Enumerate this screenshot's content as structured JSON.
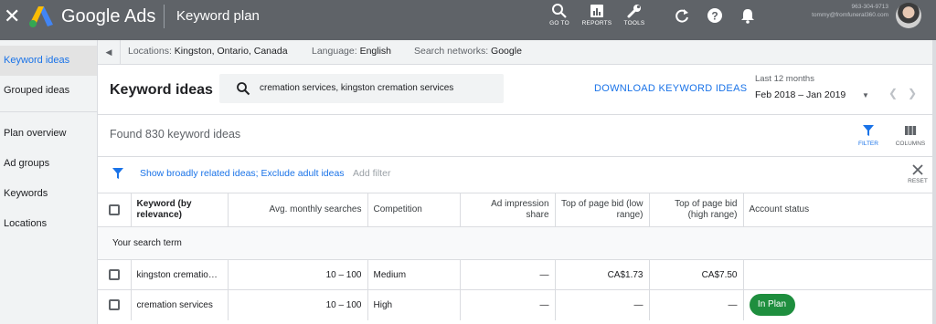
{
  "topbar": {
    "brand": "Google Ads",
    "page_title": "Keyword plan",
    "tools": [
      {
        "label": "GO TO",
        "icon": "search-icon"
      },
      {
        "label": "REPORTS",
        "icon": "reports-icon"
      },
      {
        "label": "TOOLS",
        "icon": "wrench-icon"
      }
    ],
    "account_id": "963-304-9713",
    "account_email": "tommy@fromfuneral360.com"
  },
  "sidebar": {
    "items": [
      {
        "label": "Keyword ideas",
        "active": true
      },
      {
        "label": "Grouped ideas"
      },
      {
        "label": "Plan overview"
      },
      {
        "label": "Ad groups"
      },
      {
        "label": "Keywords"
      },
      {
        "label": "Locations"
      }
    ]
  },
  "filterbar": {
    "locations_label": "Locations:",
    "locations_value": "Kingston, Ontario, Canada",
    "language_label": "Language:",
    "language_value": "English",
    "networks_label": "Search networks:",
    "networks_value": "Google"
  },
  "main": {
    "title": "Keyword ideas",
    "search_value": "cremation services, kingston cremation services",
    "download_label": "DOWNLOAD KEYWORD IDEAS",
    "date_label": "Last 12 months",
    "date_value": "Feb 2018 – Jan 2019",
    "found_text": "Found 830 keyword ideas",
    "filter_label": "FILTER",
    "columns_label": "COLUMNS",
    "filter_chip": "Show broadly related ideas; Exclude adult ideas",
    "add_filter": "Add filter",
    "reset_label": "RESET"
  },
  "table": {
    "headers": {
      "keyword": "Keyword (by relevance)",
      "searches": "Avg. monthly searches",
      "competition": "Competition",
      "impression_share": "Ad impression share",
      "bid_low": "Top of page bid (low range)",
      "bid_high": "Top of page bid (high range)",
      "status": "Account status"
    },
    "group_label": "Your search term",
    "rows": [
      {
        "keyword": "kingston cremation services",
        "searches": "10 – 100",
        "competition": "Medium",
        "impression_share": "—",
        "bid_low": "CA$1.73",
        "bid_high": "CA$7.50",
        "status": ""
      },
      {
        "keyword": "cremation services",
        "searches": "10 – 100",
        "competition": "High",
        "impression_share": "—",
        "bid_low": "—",
        "bid_high": "—",
        "status": "In Plan"
      }
    ]
  },
  "colors": {
    "accent": "#1a73e8",
    "topbar": "#5f6368",
    "in_plan": "#1e8e3e"
  }
}
